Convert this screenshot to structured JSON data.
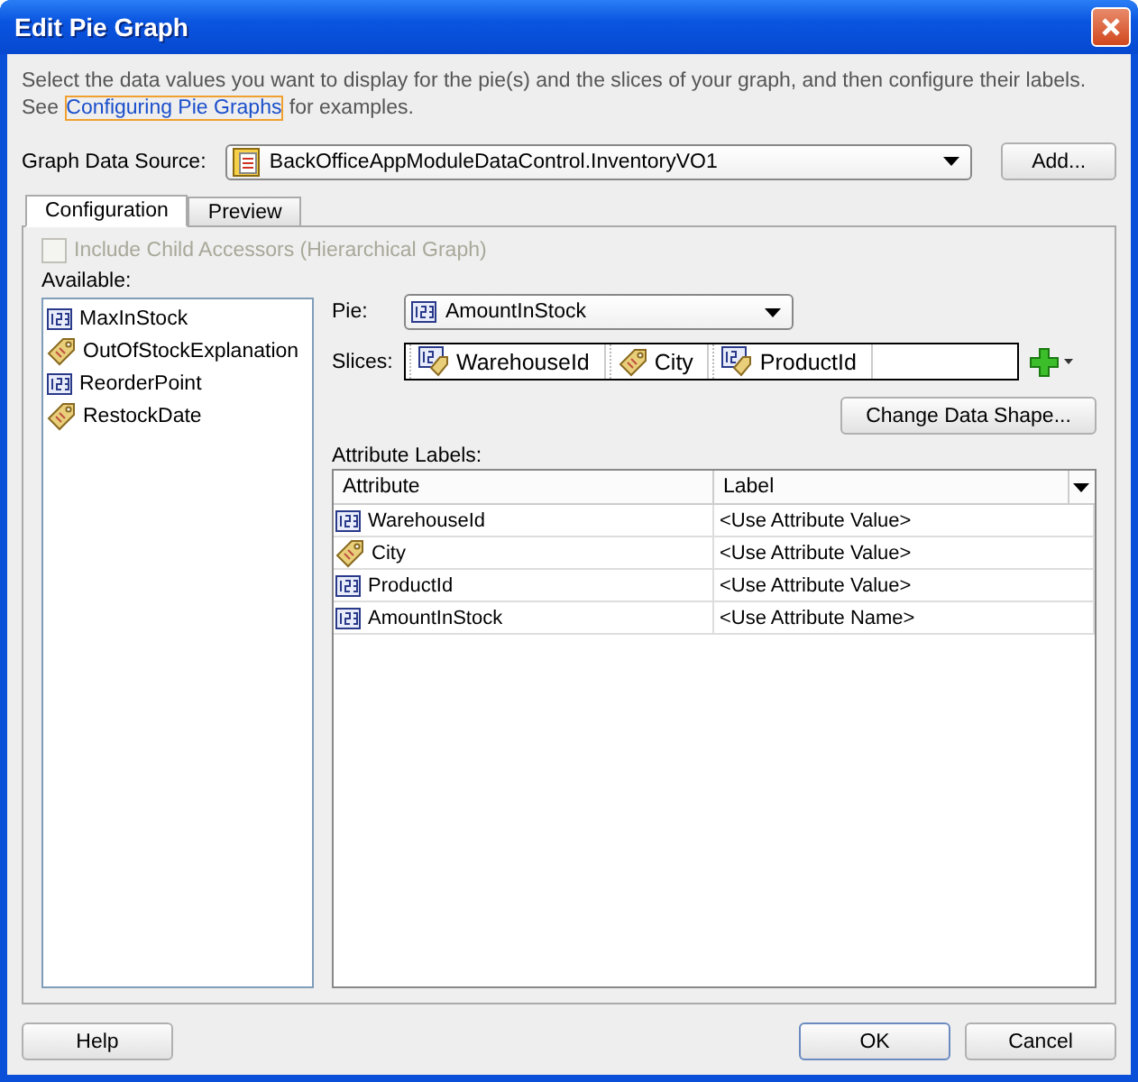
{
  "window": {
    "title": "Edit Pie Graph"
  },
  "description": {
    "text": "Select the data values you want to display for the pie(s) and the slices of your graph, and then configure their labels.",
    "prefix": "See ",
    "link": "Configuring Pie Graphs",
    "suffix": " for examples."
  },
  "data_source": {
    "label": "Graph Data Source:",
    "value": "BackOfficeAppModuleDataControl.InventoryVO1",
    "button": "Add..."
  },
  "tabs": [
    {
      "label": "Configuration",
      "selected": true
    },
    {
      "label": "Preview",
      "selected": false
    }
  ],
  "include_child": {
    "label": "Include Child Accessors (Hierarchical Graph)",
    "checked": false,
    "disabled": true
  },
  "available": {
    "label": "Available:",
    "items": [
      {
        "name": "MaxInStock",
        "kind": "number"
      },
      {
        "name": "OutOfStockExplanation",
        "kind": "tag"
      },
      {
        "name": "ReorderPoint",
        "kind": "number"
      },
      {
        "name": "RestockDate",
        "kind": "tag"
      }
    ]
  },
  "pie": {
    "label": "Pie:",
    "value": "AmountInStock",
    "kind": "number"
  },
  "slices": {
    "label": "Slices:",
    "items": [
      {
        "name": "WarehouseId",
        "kind": "number-tag"
      },
      {
        "name": "City",
        "kind": "tag"
      },
      {
        "name": "ProductId",
        "kind": "number-tag"
      }
    ]
  },
  "change_shape_button": "Change Data Shape...",
  "attribute_labels": {
    "label": "Attribute Labels:",
    "columns": [
      "Attribute",
      "Label"
    ],
    "rows": [
      {
        "attribute": "WarehouseId",
        "kind": "number",
        "label": "<Use Attribute Value>"
      },
      {
        "attribute": "City",
        "kind": "tag",
        "label": "<Use Attribute Value>"
      },
      {
        "attribute": "ProductId",
        "kind": "number",
        "label": "<Use Attribute Value>"
      },
      {
        "attribute": "AmountInStock",
        "kind": "number",
        "label": "<Use Attribute Name>"
      }
    ]
  },
  "buttons": {
    "help": "Help",
    "ok": "OK",
    "cancel": "Cancel"
  }
}
